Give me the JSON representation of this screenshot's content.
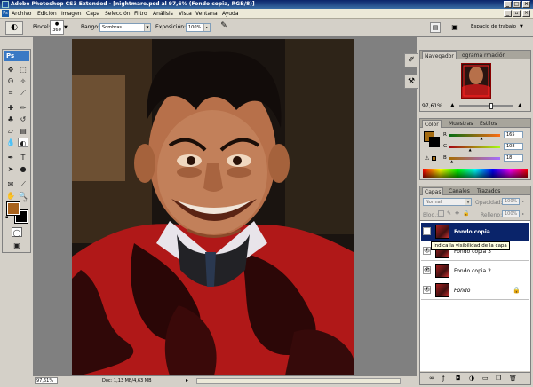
{
  "window": {
    "title": "Adobe Photoshop CS3 Extended - [nightmare.psd al 97,6% (Fondo copia, RGB/8)]"
  },
  "menu": [
    "Archivo",
    "Edición",
    "Imagen",
    "Capa",
    "Selección",
    "Filtro",
    "Análisis",
    "Vista",
    "Ventana",
    "Ayuda"
  ],
  "options": {
    "brush_label": "Pincel:",
    "brush_size": "360",
    "range_label": "Rango:",
    "range_value": "Sombras",
    "exposure_label": "Exposición:",
    "exposure_value": "100%",
    "workspace_label": "Espacio de trabajo"
  },
  "tools": {
    "logo": "Ps",
    "foreground_color": "#a8621c",
    "background_color": "#000000"
  },
  "status": {
    "zoom": "97,61%",
    "doc": "Doc: 1,13 MB/4,63 MB"
  },
  "navigator": {
    "tabs": [
      "Navegador",
      "ograma",
      "rmación"
    ],
    "zoom": "97,61%",
    "zoom_level": 0.6
  },
  "color_panel": {
    "tabs": [
      "Color",
      "Muestras",
      "Estilos"
    ],
    "channels": [
      {
        "label": "R",
        "value": "165",
        "level": 0.647
      },
      {
        "label": "G",
        "value": "108",
        "level": 0.424
      },
      {
        "label": "B",
        "value": "18",
        "level": 0.071
      }
    ],
    "swatch_color": "#a56c12"
  },
  "layers_panel": {
    "tabs": [
      "Capas",
      "Canales",
      "Trazados"
    ],
    "blend_mode": "Normal",
    "opacity_label": "Opacidad:",
    "opacity_value": "100%",
    "lock_label": "Bloq.:",
    "fill_label": "Relleno:",
    "fill_value": "100%",
    "layers": [
      {
        "name": "Fondo copia",
        "selected": true
      },
      {
        "name": "Fondo copia 3",
        "selected": false
      },
      {
        "name": "Fondo copia 2",
        "selected": false
      },
      {
        "name": "Fondo",
        "selected": false
      }
    ],
    "tooltip": "Indica la visibilidad de la capa"
  }
}
